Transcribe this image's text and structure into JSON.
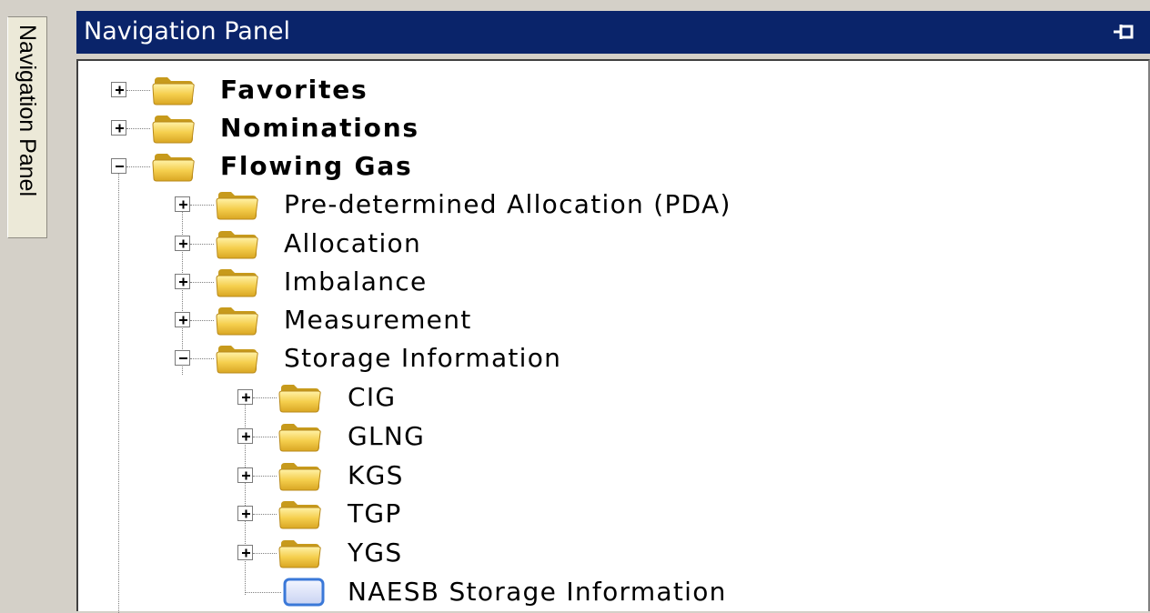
{
  "side_tab": {
    "label": "Navigation Panel"
  },
  "panel": {
    "title": "Navigation Panel"
  },
  "tree": {
    "favorites": "Favorites",
    "nominations": "Nominations",
    "flowing_gas": "Flowing Gas",
    "pda": "Pre-determined Allocation (PDA)",
    "allocation": "Allocation",
    "imbalance": "Imbalance",
    "measurement": "Measurement",
    "storage_information": "Storage Information",
    "cig": "CIG",
    "glng": "GLNG",
    "kgs": "KGS",
    "tgp": "TGP",
    "ygs": "YGS",
    "naesb": "NAESB Storage Information"
  },
  "colors": {
    "titlebar": "#0a246a",
    "folder": "#f2c94c",
    "folder_dark": "#c79a1c"
  }
}
